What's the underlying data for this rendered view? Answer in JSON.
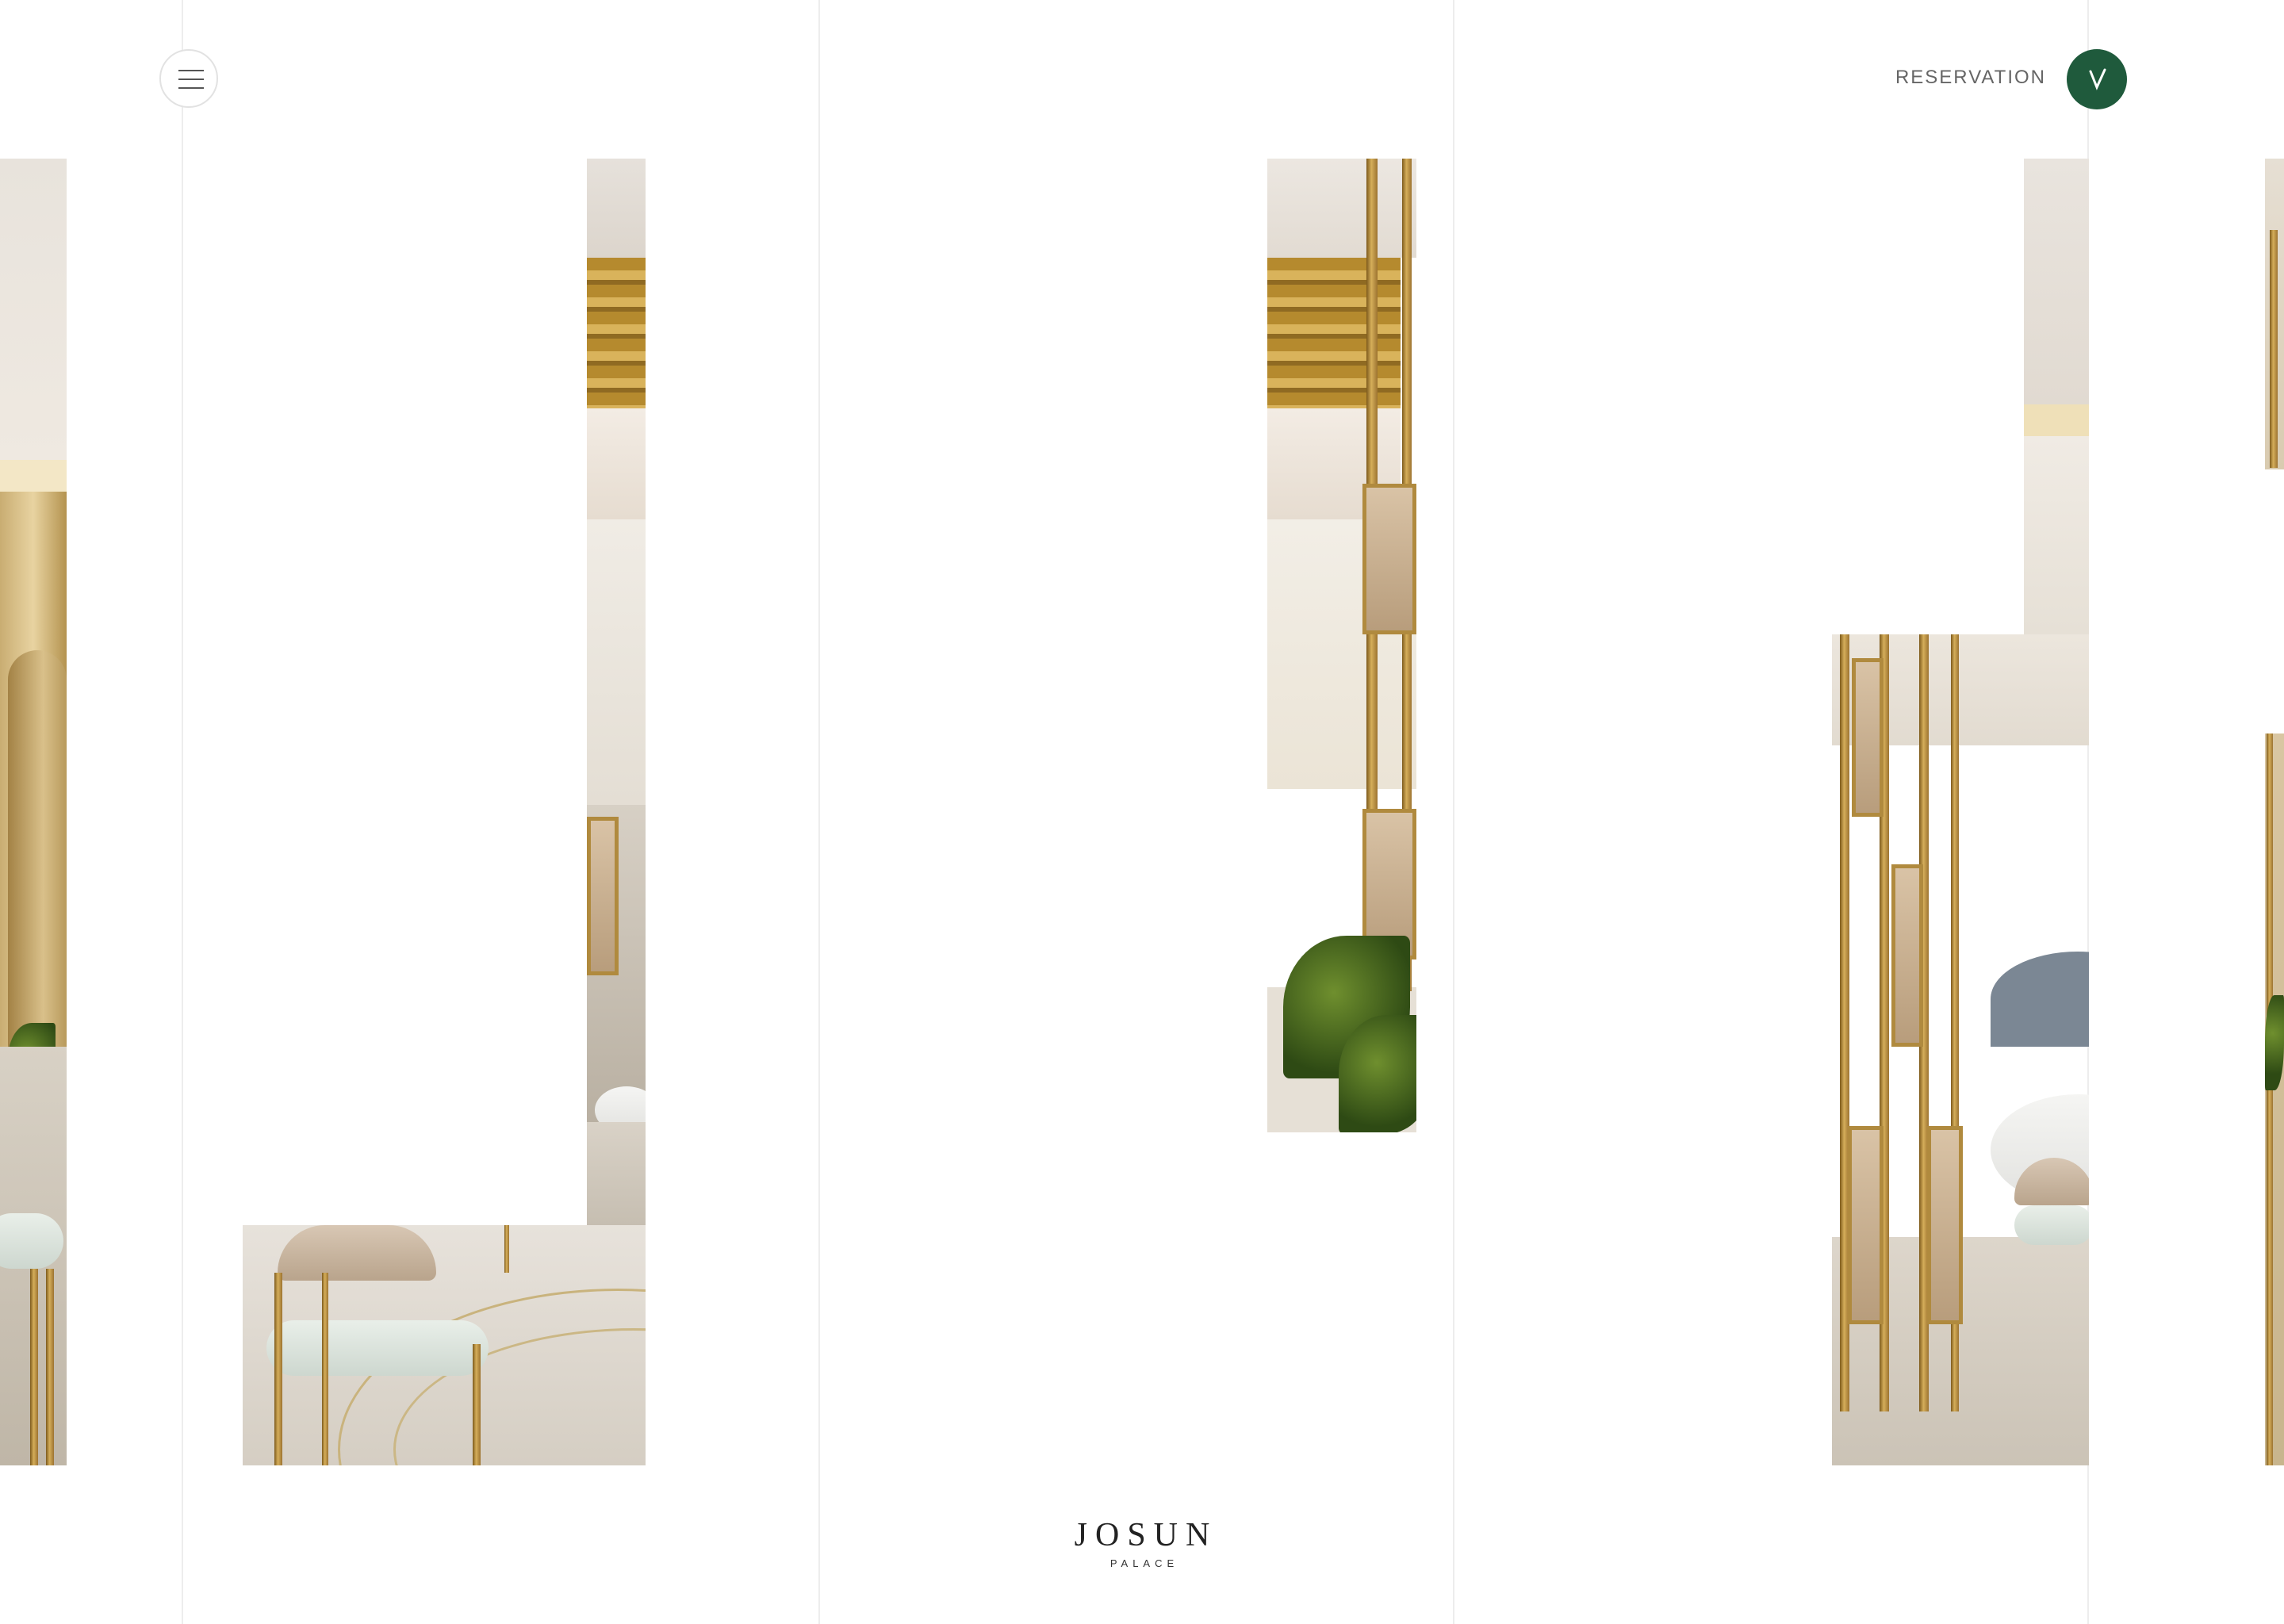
{
  "header": {
    "menu_icon": "hamburger-menu-icon",
    "reservation_label": "RESERVATION",
    "badge_icon": "v-monogram-icon",
    "badge_color": "#1f5a3c"
  },
  "footer": {
    "logo_main": "JOSUN",
    "logo_sub": "PALACE"
  },
  "colors": {
    "accent_green": "#1f5a3c",
    "gold": "#c49a45",
    "guide_line": "#ededed"
  },
  "gallery": {
    "image_subject": "restaurant interior photo strips"
  }
}
